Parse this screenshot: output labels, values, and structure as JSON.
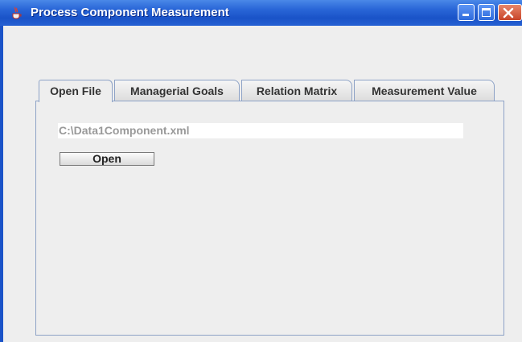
{
  "window": {
    "title": "Process Component Measurement",
    "icon": "java-cup-icon",
    "controls": {
      "minimize": "minimize-icon",
      "maximize": "maximize-icon",
      "close": "close-icon"
    }
  },
  "tabs": [
    {
      "label": "Open File",
      "selected": true
    },
    {
      "label": "Managerial Goals",
      "selected": false
    },
    {
      "label": "Relation Matrix",
      "selected": false
    },
    {
      "label": "Measurement Value",
      "selected": false
    }
  ],
  "open_file": {
    "path_value": "C:\\Data1Component.xml",
    "open_label": "Open"
  },
  "colors": {
    "titlebar": "#2a67d8",
    "close_button": "#c8452a",
    "panel_border": "#8da2c6",
    "field_text": "#999999"
  }
}
